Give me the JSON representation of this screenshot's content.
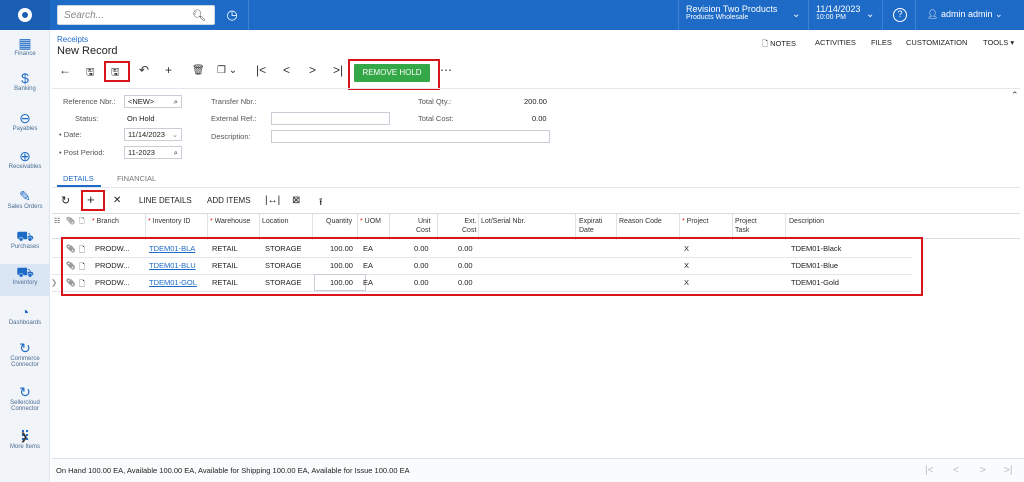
{
  "topbar": {
    "search_placeholder": "Search...",
    "tenant_line1": "Revision Two Products",
    "tenant_line2": "Products Wholesale",
    "date_line1": "11/14/2023",
    "date_line2": "10:00 PM",
    "help": "?",
    "user": "admin admin"
  },
  "nav": [
    {
      "icon": "calculator-icon",
      "glyph": "▦",
      "label": "Finance"
    },
    {
      "icon": "dollar-icon",
      "glyph": "$",
      "label": "Banking"
    },
    {
      "icon": "minus-circle-icon",
      "glyph": "⊖",
      "label": "Payables"
    },
    {
      "icon": "plus-circle-icon",
      "glyph": "⊕",
      "label": "Receivables"
    },
    {
      "icon": "edit-icon",
      "glyph": "✎",
      "label": "Sales Orders"
    },
    {
      "icon": "cart-icon",
      "glyph": "⛟",
      "label": "Purchases"
    },
    {
      "icon": "truck-icon",
      "glyph": "⛟",
      "label": "Inventory"
    },
    {
      "icon": "gauge-icon",
      "glyph": "◔",
      "label": "Dashboards"
    },
    {
      "icon": "sync-icon",
      "glyph": "↻",
      "label": "Commerce Connector"
    },
    {
      "icon": "sync-icon",
      "glyph": "↻",
      "label": "Sellercloud Connector"
    },
    {
      "icon": "grid-icon",
      "glyph": "⠿",
      "label": "More Items"
    }
  ],
  "header": {
    "breadcrumb": "Receipts",
    "title": "New Record",
    "links": [
      "NOTES",
      "ACTIVITIES",
      "FILES",
      "CUSTOMIZATION",
      "TOOLS"
    ]
  },
  "toolbar": {
    "remove_hold": "REMOVE HOLD"
  },
  "form": {
    "reference_nbr_label": "Reference Nbr.:",
    "reference_nbr": "<NEW>",
    "status_label": "Status:",
    "status": "On Hold",
    "date_label": "Date:",
    "date": "11/14/2023",
    "post_period_label": "Post Period:",
    "post_period": "11-2023",
    "transfer_nbr_label": "Transfer Nbr.:",
    "external_ref_label": "External Ref.:",
    "description_label": "Description:",
    "total_qty_label": "Total Qty.:",
    "total_qty": "200.00",
    "total_cost_label": "Total Cost:",
    "total_cost": "0.00"
  },
  "tabs": [
    "DETAILS",
    "FINANCIAL"
  ],
  "grid_toolbar": {
    "line_details": "LINE DETAILS",
    "add_items": "ADD ITEMS"
  },
  "grid": {
    "headers": {
      "branch": "Branch",
      "inventory_id": "Inventory ID",
      "warehouse": "Warehouse",
      "location": "Location",
      "quantity": "Quantity",
      "uom": "UOM",
      "unit_cost_1": "Unit",
      "unit_cost_2": "Cost",
      "ext_cost_1": "Ext.",
      "ext_cost_2": "Cost",
      "lot_serial": "Lot/Serial Nbr.",
      "expiration_1": "Expirati",
      "expiration_2": "Date",
      "reason_code": "Reason Code",
      "project": "Project",
      "project_task_1": "Project",
      "project_task_2": "Task",
      "description": "Description"
    },
    "rows": [
      {
        "branch": "PRODW...",
        "inventory_id": "TDEM01-BLA",
        "warehouse": "RETAIL",
        "location": "STORAGE",
        "quantity": "100.00",
        "uom": "EA",
        "unit_cost": "0.00",
        "ext_cost": "0.00",
        "project": "X",
        "description": "TDEM01-Black"
      },
      {
        "branch": "PRODW...",
        "inventory_id": "TDEM01-BLU",
        "warehouse": "RETAIL",
        "location": "STORAGE",
        "quantity": "100.00",
        "uom": "EA",
        "unit_cost": "0.00",
        "ext_cost": "0.00",
        "project": "X",
        "description": "TDEM01-Blue"
      },
      {
        "branch": "PRODW...",
        "inventory_id": "TDEM01-GOL",
        "warehouse": "RETAIL",
        "location": "STORAGE",
        "quantity": "100.00",
        "uom": "EA",
        "unit_cost": "0.00",
        "ext_cost": "0.00",
        "project": "X",
        "description": "TDEM01-Gold"
      }
    ]
  },
  "footer": {
    "availability": "On Hand 100.00 EA, Available 100.00 EA, Available for Shipping 100.00 EA, Available for Issue 100.00 EA"
  },
  "colors": {
    "topbar": "#1e6bc7",
    "highlight": "#d9141b",
    "remove_hold": "#34a846"
  }
}
